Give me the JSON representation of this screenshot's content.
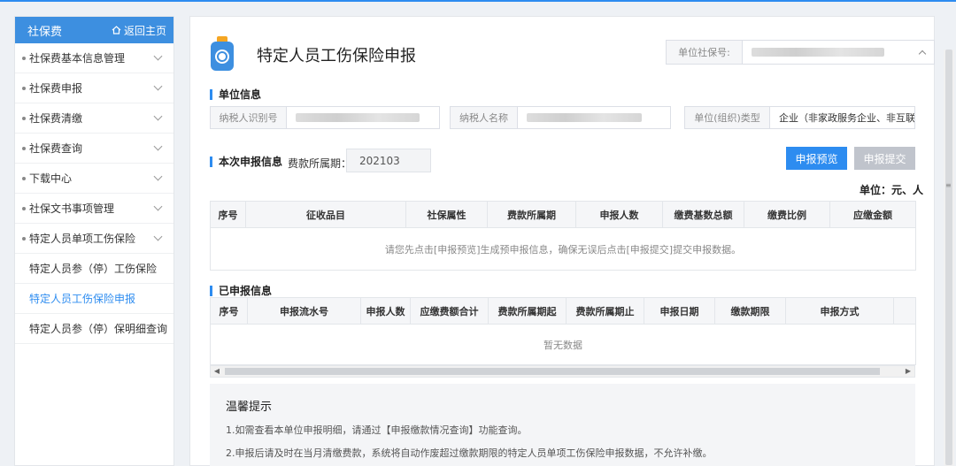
{
  "sidebar": {
    "header_title": "社保费",
    "home_label": "返回主页",
    "items": [
      {
        "label": "社保费基本信息管理"
      },
      {
        "label": "社保费申报"
      },
      {
        "label": "社保费清缴"
      },
      {
        "label": "社保费查询"
      },
      {
        "label": "下载中心"
      },
      {
        "label": "社保文书事项管理"
      },
      {
        "label": "特定人员单项工伤保险"
      }
    ],
    "sub_items": [
      {
        "label": "特定人员参（停）工伤保险"
      },
      {
        "label": "特定人员工伤保险申报"
      },
      {
        "label": "特定人员参（停）保明细查询"
      }
    ]
  },
  "page": {
    "title": "特定人员工伤保险申报",
    "unit_ss_label": "单位社保号:"
  },
  "unit_info": {
    "title": "单位信息",
    "taxpayer_id_label": "纳税人识别号",
    "taxpayer_name_label": "纳税人名称",
    "org_type_label": "单位(组织)类型",
    "org_type_value": "企业（非家政服务企业、非互联网"
  },
  "declare": {
    "title": "本次申报信息",
    "period_label": "费款所属期：",
    "period_value": "202103",
    "preview_button": "申报预览",
    "submit_button": "申报提交",
    "unit_note": "单位：元、人",
    "columns": [
      "序号",
      "征收品目",
      "社保属性",
      "费款所属期",
      "申报人数",
      "缴费基数总额",
      "缴费比例",
      "应缴金额"
    ],
    "empty_text": "请您先点击[申报预览]生成预申报信息，确保无误后点击[申报提交]提交申报数据。"
  },
  "declared": {
    "title": "已申报信息",
    "columns": [
      "序号",
      "申报流水号",
      "申报人数",
      "应缴费额合计",
      "费款所属期起",
      "费款所属期止",
      "申报日期",
      "缴款期限",
      "申报方式"
    ],
    "empty_text": "暂无数据"
  },
  "tips": {
    "title": "温馨提示",
    "lines": [
      "1.如需查看本单位申报明细，请通过【申报缴款情况查询】功能查询。",
      "2.申报后请及时在当月清缴费款，系统将自动作废超过缴款期限的特定人员单项工伤保险申报数据，不允许补缴。"
    ]
  },
  "icons": {
    "home": "home-icon",
    "page": "insurance-badge-icon"
  },
  "colors": {
    "accent": "#2d8cf0",
    "sidebar_header": "#3d8fe0",
    "disabled": "#c0c4cc"
  }
}
